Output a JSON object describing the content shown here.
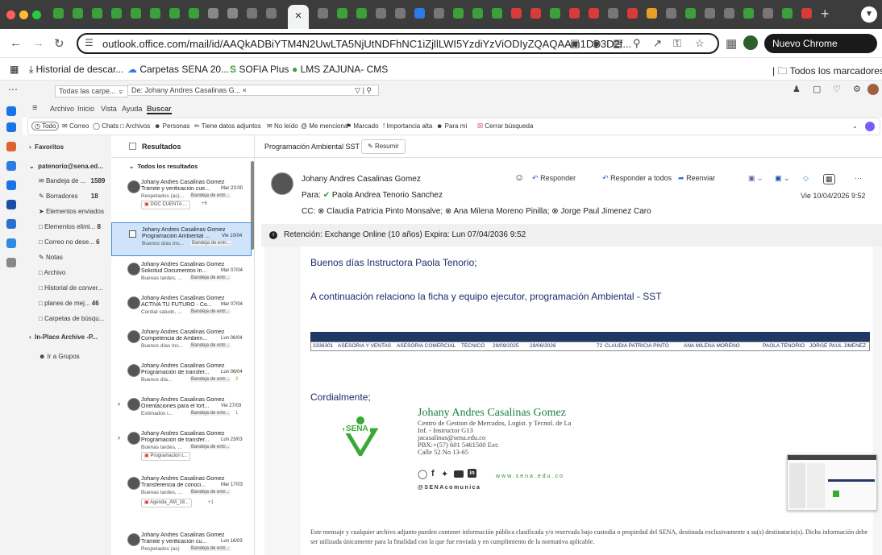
{
  "browser": {
    "url": "outlook.office.com/mail/id/AAQkADBiYTM4N2UwLTA5NjUtNDFhNC1iZjllLWI5YzdiYzViODIyZQAQAAm1DB3D2f...",
    "update_button": "Nuevo Chrome disponible",
    "active_tab_close": "×",
    "new_tab": "+"
  },
  "bookmarks": {
    "items": [
      "Historial de descar...",
      "Carpetas SENA 20...",
      "SOFIA Plus",
      "LMS ZAJUNA- CMS"
    ],
    "all": "Todos los marcadores"
  },
  "owa_top": {
    "folder_scope": "Todas las carpe...",
    "search_chip": "De: Johany Andres Casalinas G..."
  },
  "ribbon": {
    "tabs": [
      "Archivo",
      "Inicio",
      "Vista",
      "Ayuda",
      "Buscar"
    ]
  },
  "search_toolbar": {
    "items": [
      "Todo",
      "Correo",
      "Chats",
      "Archivos",
      "Personas",
      "Tiene datos adjuntos",
      "No leído",
      "Me menciona",
      "Marcado",
      "Importancia alta",
      "Para mí",
      "Cerrar búsqueda"
    ]
  },
  "folders": {
    "favorites": "Favoritos",
    "account": "patenorio@sena.ed...",
    "items": [
      {
        "label": "Bandeja de ...",
        "count": "1589"
      },
      {
        "label": "Borradores",
        "count": "18"
      },
      {
        "label": "Elementos enviados",
        "count": ""
      },
      {
        "label": "Elementos elimi...",
        "count": "8"
      },
      {
        "label": "Correo no dese...",
        "count": "6"
      },
      {
        "label": "Notas",
        "count": ""
      },
      {
        "label": "Archivo",
        "count": ""
      },
      {
        "label": "Historial de conver...",
        "count": ""
      },
      {
        "label": "planes de mej...",
        "count": "46"
      },
      {
        "label": "Carpetas de búsqu...",
        "count": ""
      }
    ],
    "archive": "In-Place Archive -P...",
    "groups": "Ir a Grupos"
  },
  "message_list": {
    "header": "Resultados",
    "group": "Todos los resultados",
    "items": [
      {
        "sender": "Johany Andres Casalinas Gomez",
        "subject": "Trámite y verificación cue...",
        "date": "Mar 23:00",
        "preview": "Respetados (as)...",
        "tag": "Bandeja de entr...",
        "attachment": "DOC CUENTA ...",
        "more": "+6"
      },
      {
        "sender": "Johany Andres Casalinas Gomez",
        "subject": "Programación Ambiental ...",
        "date": "Vie 10/04",
        "preview": "Buenos días Ins...",
        "tag": "Bandeja de entr...",
        "attachment": "",
        "more": ""
      },
      {
        "sender": "Johany Andres Casalinas Gomez",
        "subject": "Solicitud Documentos In...",
        "date": "Mar 07/04",
        "preview": "Buenas tardes; ...",
        "tag": "Bandeja de entr...",
        "attachment": "",
        "more": ""
      },
      {
        "sender": "Johany Andres Casalinas Gomez",
        "subject": "ACTIVA TU FUTURO - Co...",
        "date": "Mar 07/04",
        "preview": "Cordial saludo, ...",
        "tag": "Bandeja de entr...",
        "attachment": "",
        "more": ""
      },
      {
        "sender": "Johany Andres Casalinas Gomez",
        "subject": "Competencia de Ambien...",
        "date": "Lun 06/04",
        "preview": "Buenos días Ins...",
        "tag": "Bandeja de entr...",
        "attachment": "",
        "more": ""
      },
      {
        "sender": "Johany Andres Casalinas Gomez",
        "subject": "Programación de transfer...",
        "date": "Lun 06/04",
        "preview": "Buenos día...",
        "tag": "Bandeja de entr...",
        "attachment": "",
        "more": "2"
      },
      {
        "sender": "Johany Andres Casalinas Gomez",
        "subject": "Orientaciones para el fort...",
        "date": "Vie 27/03",
        "preview": "Estimados i...",
        "tag": "Bandeja de entr...",
        "attachment": "",
        "more": "1"
      },
      {
        "sender": "Johany Andres Casalinas Gomez",
        "subject": "Programación de transfer...",
        "date": "Lun 23/03",
        "preview": "Buenas tardes, ...",
        "tag": "Bandeja de entr...",
        "attachment": "Programacion t...",
        "more": ""
      },
      {
        "sender": "Johany Andres Casalinas Gomez",
        "subject": "Transferencia de conoci...",
        "date": "Mar 17/03",
        "preview": "Buenas tardes, ...",
        "tag": "Bandeja de entr...",
        "attachment": "Agenda_AM_18...",
        "more": "+1"
      },
      {
        "sender": "Johany Andres Casalinas Gomez",
        "subject": "Trámite y verificación cu...",
        "date": "Lun 16/03",
        "preview": "Respetados (as)",
        "tag": "Bandeja de entr...",
        "attachment": "",
        "more": ""
      }
    ]
  },
  "reading": {
    "title": "Programación Ambiental SST",
    "summarize": "Resumir",
    "from": "Johany Andres Casalinas Gomez",
    "to_label": "Para:",
    "to": "Paola Andrea Tenorio Sanchez",
    "cc_label": "CC:",
    "cc": [
      "Claudia Patricia Pinto Monsalve;",
      "Ana Milena Moreno Pinilla;",
      "Jorge Paul Jimenez Caro"
    ],
    "reply": "Responder",
    "reply_all": "Responder a todos",
    "forward": "Reenviar",
    "more": "···",
    "date": "Vie 10/04/2026 9:52",
    "retention": "Retención: Exchange Online (10 años) Expira: Lun 07/04/2036 9:52",
    "greeting": "Buenos días Instructora Paola Tenorio;",
    "intro": "A continuación relaciono la ficha y equipo ejecutor, programación Ambiental - SST",
    "table_row": [
      "3336301",
      "ASESORIA Y VENTAS",
      "ASESORIA COMERCIAL",
      "TECNICO",
      "29/09/2025",
      "29/06/2026",
      "72",
      "CLAUDIA PATRICIA PINTO",
      "ANA MILENA MORENO",
      "PAOLA TENORIO",
      "JORGE PAUL JIMENEZ"
    ],
    "closing": "Cordialmente;",
    "sig_name": "Johany Andres Casalinas Gomez",
    "sig_lines": [
      "Centro de Gestion de Mercados, Logist. y Tecnol. de La",
      "Inf. - Instructor G13",
      "jacasalinas@sena.edu.co",
      "PBX:+(57) 601 5461500 Ext:",
      "Calle 52 No 13-65"
    ],
    "sena_logo_text": "SENA",
    "sena_web": "www.sena.edu.co",
    "sena_handle": "@SENAcomunica",
    "disclaimer": "Este mensaje y cualquier archivo adjunto pueden contener información pública clasificada y/o reservada bajo custodia o propiedad del SENA, destinada exclusivamente a su(s) destinatario(s). Dicha información debe ser utilizada únicamente para la finalidad con la que fue enviada y en cumplimiento de la normativa aplicable."
  }
}
